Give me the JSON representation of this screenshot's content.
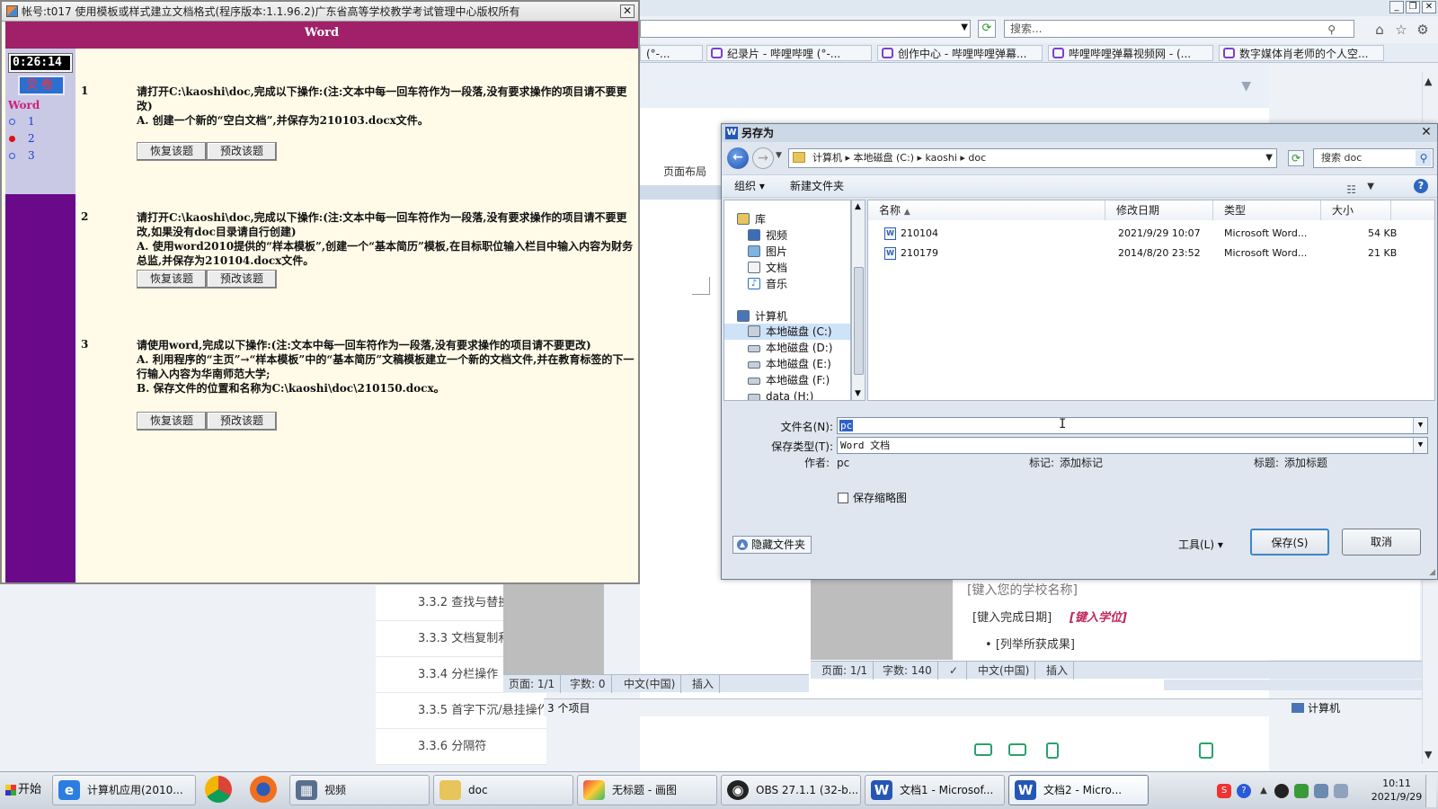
{
  "browser": {
    "search_placeholder": "搜索...",
    "favorites": [
      "(°-...",
      "纪录片 - 哔哩哔哩 (°-...",
      "创作中心 - 哔哩哔哩弹幕...",
      "哔哩哔哩弹幕视频网 - (...",
      "数字媒体肖老师的个人空..."
    ],
    "page_layout_tab": "页面布局"
  },
  "toc": [
    "3.3.2 查找与替换",
    "3.3.3 文档复制和",
    "3.3.4 分栏操作",
    "3.3.5 首字下沉/悬挂操作",
    "3.3.6 分隔符"
  ],
  "word1_status": {
    "page": "页面: 1/1",
    "words": "字数: 0",
    "lang": "中文(中国)",
    "mode": "插入"
  },
  "word2_status": {
    "page": "页面: 1/1",
    "words": "字数: 140",
    "lang": "中文(中国)",
    "mode": "插入"
  },
  "word2_doc": {
    "school": "[键入您的学校名称]",
    "date": "[键入完成日期]",
    "degree": "[键入学位]",
    "achievement": "[列举所获成果]"
  },
  "explorer_status": {
    "count": "3 个项目",
    "location": "计算机"
  },
  "exam": {
    "title": "帐号:t017  使用模板或样式建立文档格式(程序版本:1.1.96.2)广东省高等学校教学考试管理中心版权所有",
    "header": "Word",
    "timer": "0:26:14",
    "submit": "交卷",
    "subject": "Word",
    "nav": [
      "1",
      "2",
      "3"
    ],
    "restore": "恢复该题",
    "preview": "预改该题",
    "questions": [
      {
        "num": "1",
        "lines": [
          "请打开C:\\kaoshi\\doc,完成以下操作:(注:文本中每一回车符作为一段落,没有要求操作的项目请不要更改)",
          "A. 创建一个新的“空白文档”,并保存为210103.docx文件。"
        ]
      },
      {
        "num": "2",
        "lines": [
          "请打开C:\\kaoshi\\doc,完成以下操作:(注:文本中每一回车符作为一段落,没有要求操作的项目请不要更改,如果没有doc目录请自行创建)",
          "A. 使用word2010提供的“样本模板”,创建一个“基本简历”模板,在目标职位输入栏目中输入内容为财务总监,并保存为210104.docx文件。"
        ]
      },
      {
        "num": "3",
        "lines": [
          "请使用word,完成以下操作:(注:文本中每一回车符作为一段落,没有要求操作的项目请不要更改)",
          "A. 利用程序的“主页”→“样本模板”中的“基本简历”文稿模板建立一个新的文档文件,并在教育标签的下一行输入内容为华南师范大学;",
          "B. 保存文件的位置和名称为C:\\kaoshi\\doc\\210150.docx。"
        ]
      }
    ]
  },
  "dialog": {
    "title": "另存为",
    "breadcrumb": "计算机 ▸ 本地磁盘 (C:) ▸ kaoshi ▸ doc",
    "search": "搜索 doc",
    "organize": "组织 ▾",
    "new_folder": "新建文件夹",
    "tree": [
      "库",
      "视频",
      "图片",
      "文档",
      "音乐",
      "计算机",
      "本地磁盘 (C:)",
      "本地磁盘 (D:)",
      "本地磁盘 (E:)",
      "本地磁盘 (F:)",
      "data (H:)"
    ],
    "columns": [
      "名称",
      "修改日期",
      "类型",
      "大小"
    ],
    "files": [
      {
        "name": "210104",
        "date": "2021/9/29 10:07",
        "type": "Microsoft Word...",
        "size": "54 KB"
      },
      {
        "name": "210179",
        "date": "2014/8/20 23:52",
        "type": "Microsoft Word...",
        "size": "21 KB"
      }
    ],
    "filename_label": "文件名(N):",
    "filename_value": "pc",
    "filetype_label": "保存类型(T):",
    "filetype_value": "Word 文档",
    "author_label": "作者:",
    "author_value": "pc",
    "tags_label": "标记:",
    "tags_value": "添加标记",
    "title_label": "标题:",
    "title_value": "添加标题",
    "thumb_label": "保存缩略图",
    "hide_folders": "隐藏文件夹",
    "tools": "工具(L)  ▾",
    "save": "保存(S)",
    "cancel": "取消"
  },
  "taskbar": {
    "start": "开始",
    "items": [
      "计算机应用(2010...",
      "视频",
      "doc",
      "无标题 - 画图",
      "OBS 27.1.1 (32-b...",
      "文档1 - Microsof...",
      "文档2 - Micro..."
    ],
    "time": "10:11",
    "date": "2021/9/29"
  }
}
